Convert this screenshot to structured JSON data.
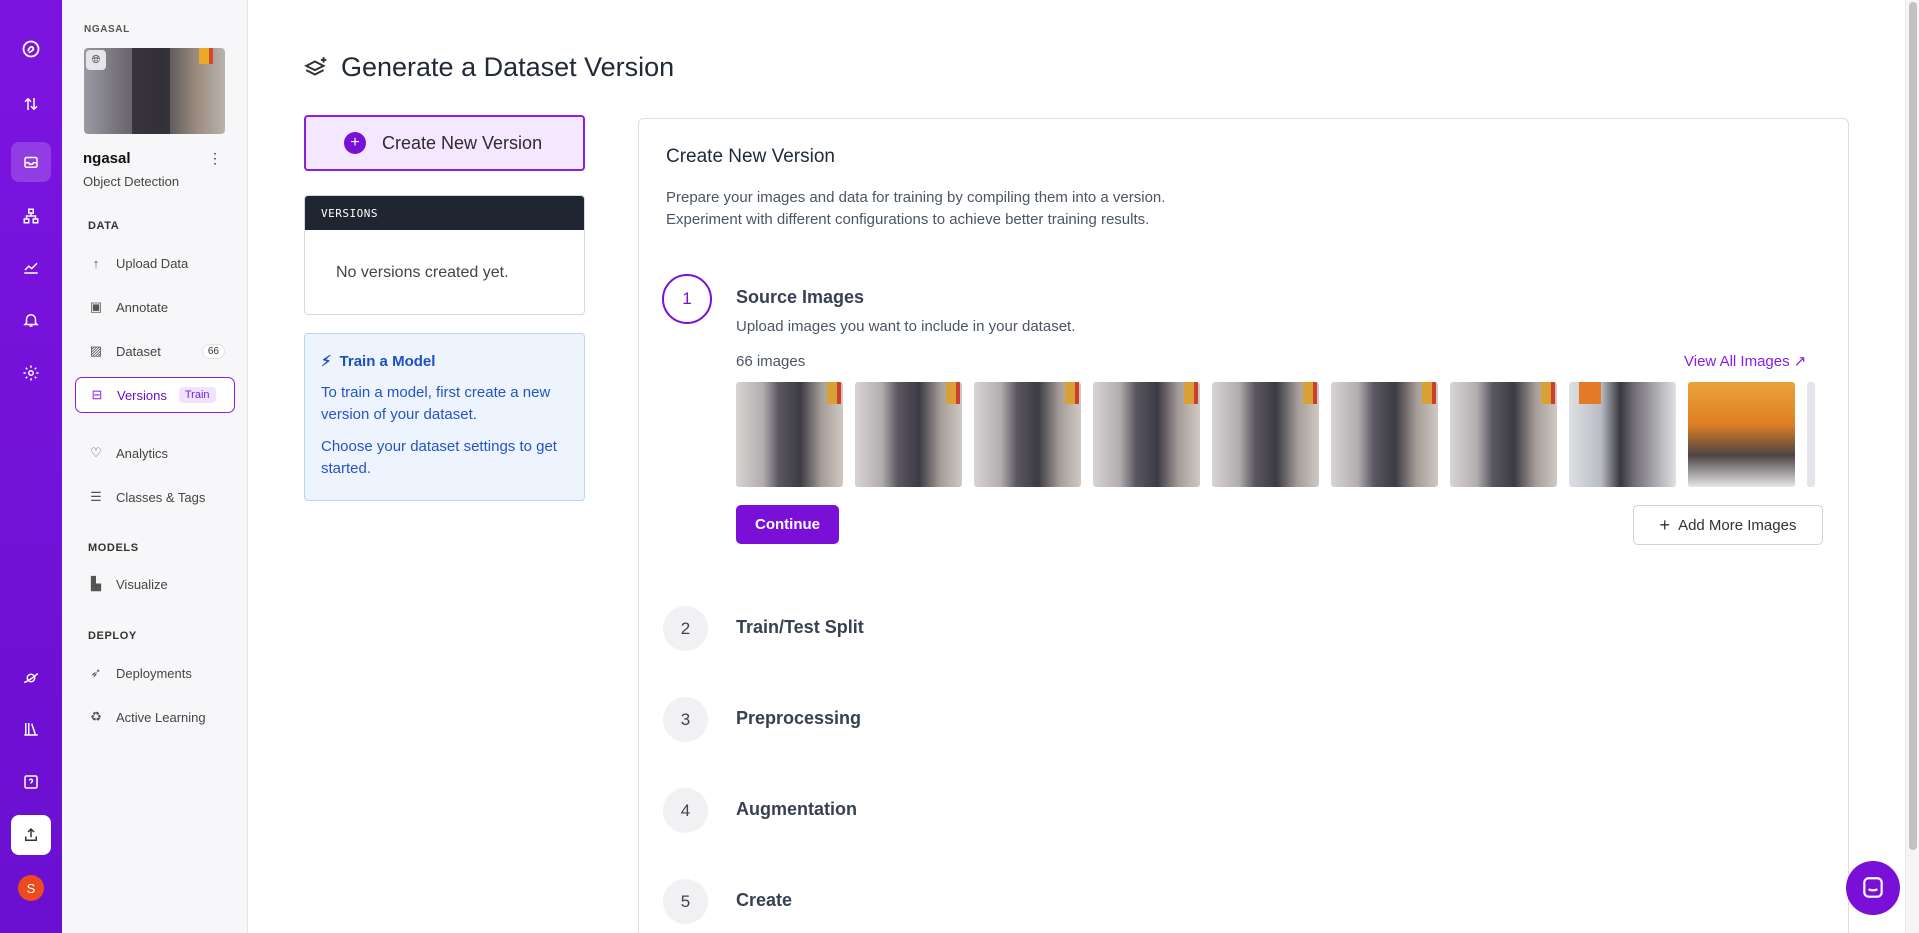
{
  "rail": {
    "icons": [
      "roboflow-logo-icon",
      "transfer-icon",
      "inbox-icon",
      "workflow-icon",
      "chart-icon",
      "bell-icon",
      "gear-icon",
      "planet-icon",
      "library-icon",
      "help-icon",
      "upload-icon"
    ],
    "avatar_letter": "S"
  },
  "sidebar": {
    "workspace_label": "NGASAL",
    "project_name": "ngasal",
    "project_type": "Object Detection",
    "sections": {
      "data": "DATA",
      "models": "MODELS",
      "deploy": "DEPLOY"
    },
    "items": [
      {
        "label": "Upload Data",
        "icon": "upload-arrow-icon"
      },
      {
        "label": "Annotate",
        "icon": "annotate-icon"
      },
      {
        "label": "Dataset",
        "icon": "image-icon",
        "count": "66"
      },
      {
        "label": "Versions",
        "icon": "versions-icon",
        "badge": "Train"
      },
      {
        "label": "Analytics",
        "icon": "heart-pulse-icon"
      },
      {
        "label": "Classes & Tags",
        "icon": "list-icon"
      },
      {
        "label": "Visualize",
        "icon": "bar-chart-icon"
      },
      {
        "label": "Deployments",
        "icon": "rocket-icon"
      },
      {
        "label": "Active Learning",
        "icon": "recycle-icon"
      }
    ]
  },
  "page": {
    "title": "Generate a Dataset Version"
  },
  "left": {
    "create_button": "Create New Version",
    "versions_header": "VERSIONS",
    "versions_empty": "No versions created yet.",
    "train_title": "Train a Model",
    "train_p1": "To train a model, first create a new version of your dataset.",
    "train_p2": "Choose your dataset settings to get started."
  },
  "main": {
    "title": "Create New Version",
    "desc1": "Prepare your images and data for training by compiling them into a version.",
    "desc2": "Experiment with different configurations to achieve better training results.",
    "steps": [
      {
        "num": "1",
        "title": "Source Images"
      },
      {
        "num": "2",
        "title": "Train/Test Split"
      },
      {
        "num": "3",
        "title": "Preprocessing"
      },
      {
        "num": "4",
        "title": "Augmentation"
      },
      {
        "num": "5",
        "title": "Create"
      }
    ],
    "source_sub": "Upload images you want to include in your dataset.",
    "image_count": "66 images",
    "view_all": "View All Images ↗",
    "continue": "Continue",
    "add_more": "Add More Images"
  },
  "colors": {
    "brand": "#7a10d8",
    "rail": "#6a0fd0",
    "info_bg": "#eef4fd",
    "info_text": "#2454c4"
  }
}
